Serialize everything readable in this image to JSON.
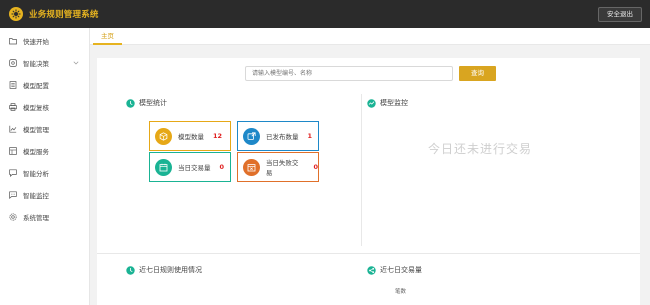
{
  "app": {
    "title": "业务规则管理系统",
    "logout": "安全退出"
  },
  "sidebar": {
    "items": [
      {
        "label": "快速开始",
        "icon": "folder-icon"
      },
      {
        "label": "智能决策",
        "icon": "settings-icon",
        "has_arrow": true
      },
      {
        "label": "模型配置",
        "icon": "list-icon"
      },
      {
        "label": "模型复核",
        "icon": "printer-icon"
      },
      {
        "label": "模型管理",
        "icon": "chart-icon"
      },
      {
        "label": "模型服务",
        "icon": "grid-icon"
      },
      {
        "label": "智能分析",
        "icon": "chat-icon"
      },
      {
        "label": "智能监控",
        "icon": "message-icon"
      },
      {
        "label": "系统管理",
        "icon": "gear-icon"
      }
    ]
  },
  "tabs": [
    {
      "label": "主页"
    }
  ],
  "search": {
    "placeholder": "请输入模型编号、名称",
    "button": "查询"
  },
  "model_stats": {
    "title": "模型统计",
    "cards": [
      {
        "label": "模型数量",
        "value": "12",
        "color": "#e6a817",
        "icon": "cube-icon"
      },
      {
        "label": "已发布数量",
        "value": "1",
        "color": "#1e88c8",
        "icon": "publish-icon"
      },
      {
        "label": "当日交易量",
        "value": "0",
        "color": "#1ab394",
        "icon": "calendar-icon"
      },
      {
        "label": "当日失败交易",
        "value": "0",
        "color": "#e0702a",
        "icon": "alert-icon"
      }
    ]
  },
  "model_monitor": {
    "title": "模型监控",
    "empty": "今日还未进行交易"
  },
  "rule_usage": {
    "title": "近七日规则使用情况"
  },
  "trade_volume": {
    "title": "近七日交易量",
    "unit": "笔数"
  },
  "colors": {
    "accent": "#e6b320",
    "topbar": "#2b2b2b",
    "title_icon": "#1ab394"
  }
}
